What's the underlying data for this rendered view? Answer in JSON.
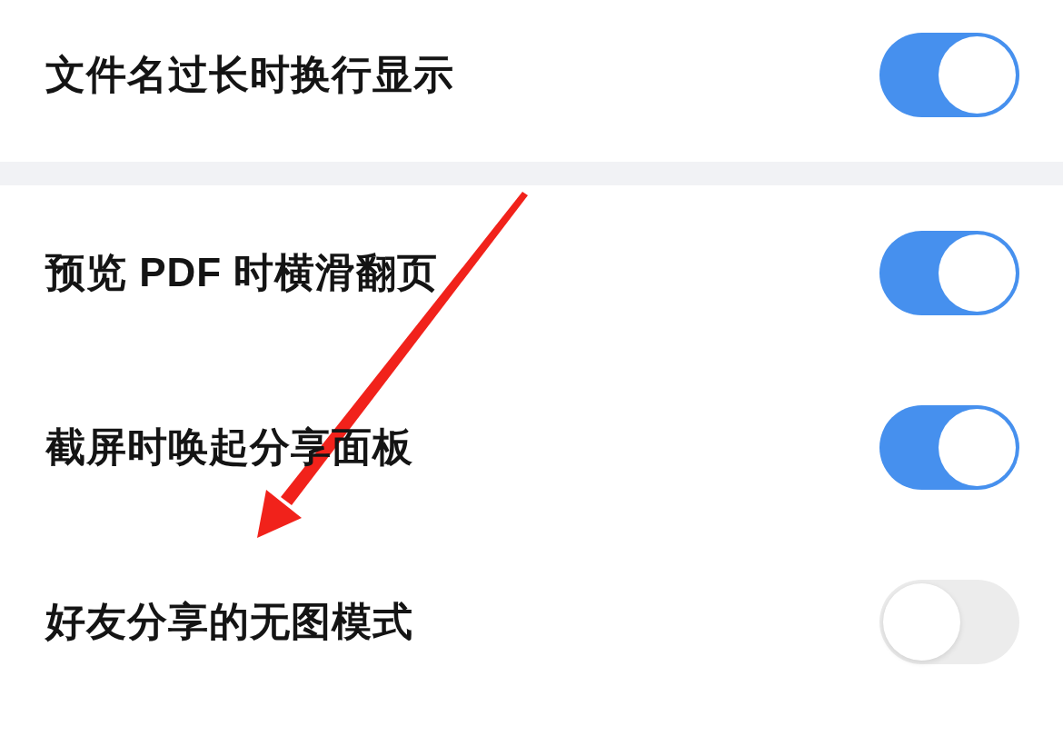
{
  "sections": [
    {
      "items": [
        {
          "label": "文件名过长时换行显示",
          "on": true
        }
      ]
    },
    {
      "items": [
        {
          "label": "预览 PDF 时横滑翻页",
          "on": true
        },
        {
          "label": "截屏时唤起分享面板",
          "on": true
        },
        {
          "label": "好友分享的无图模式",
          "on": false
        }
      ]
    }
  ]
}
